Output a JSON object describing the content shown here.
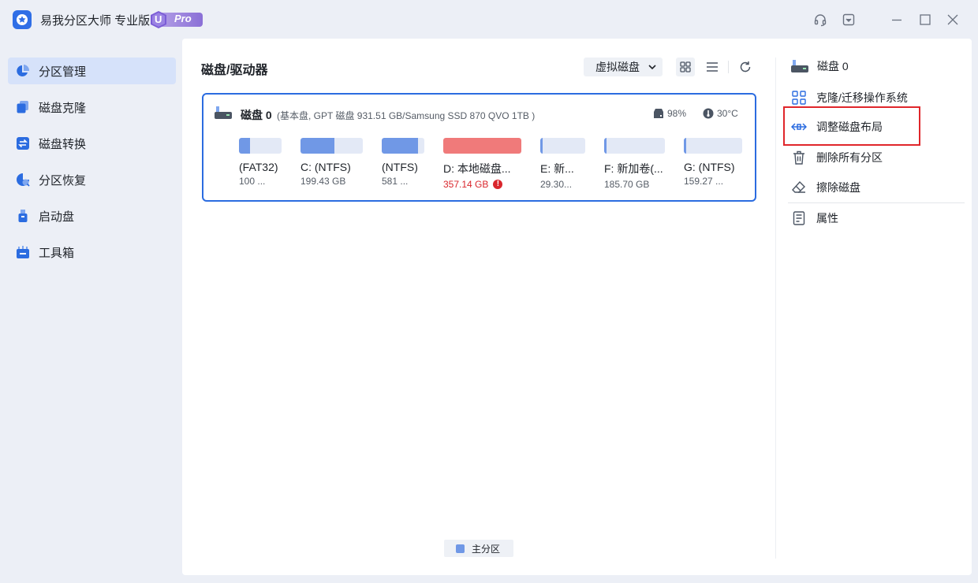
{
  "app": {
    "title": "易我分区大师 专业版",
    "badge": "Pro",
    "badge_letter": "U"
  },
  "window_controls": [
    "headset-icon",
    "dropdown-icon",
    "minimize-icon",
    "maximize-icon",
    "close-icon"
  ],
  "sidebar": {
    "items": [
      {
        "label": "分区管理",
        "icon": "pie-chart-icon",
        "active": true
      },
      {
        "label": "磁盘克隆",
        "icon": "clone-icon",
        "active": false
      },
      {
        "label": "磁盘转换",
        "icon": "convert-icon",
        "active": false
      },
      {
        "label": "分区恢复",
        "icon": "recovery-icon",
        "active": false
      },
      {
        "label": "启动盘",
        "icon": "usb-icon",
        "active": false
      },
      {
        "label": "工具箱",
        "icon": "toolbox-icon",
        "active": false
      }
    ]
  },
  "main": {
    "title": "磁盘/驱动器",
    "virtual_disk_label": "虚拟磁盘",
    "disk": {
      "name": "磁盘 0",
      "info": "(基本盘, GPT 磁盘 931.51 GB/Samsung SSD 870 QVO 1TB )",
      "health": "98%",
      "temperature": "30°C",
      "partitions": [
        {
          "name": "(FAT32)",
          "size": "100 ...",
          "used": 0.25,
          "warning": false
        },
        {
          "name": "C: (NTFS)",
          "size": "199.43 GB",
          "used": 0.55,
          "warning": false
        },
        {
          "name": "(NTFS)",
          "size": "581 ...",
          "used": 0.85,
          "warning": false
        },
        {
          "name": "D: 本地磁盘...",
          "size": "357.14 GB",
          "used": 1.0,
          "warning": true
        },
        {
          "name": "E: 新...",
          "size": "29.30...",
          "used": 0.06,
          "warning": false
        },
        {
          "name": "F: 新加卷(...",
          "size": "185.70 GB",
          "used": 0.04,
          "warning": false
        },
        {
          "name": "G: (NTFS)",
          "size": "159.27 ...",
          "used": 0.04,
          "warning": false
        }
      ]
    },
    "legend": "主分区"
  },
  "colors": {
    "accent": "#2b6ce0",
    "partition_fill": "#7098e6",
    "partition_warning": "#f07a7a",
    "partition_track": "#e3e9f6",
    "highlight": "#e0262b"
  },
  "right_panel": {
    "title": "磁盘 0",
    "actions": [
      {
        "label": "克隆/迁移操作系统",
        "icon": "clone-os-icon"
      },
      {
        "label": "调整磁盘布局",
        "icon": "resize-arrows-icon"
      },
      {
        "label": "删除所有分区",
        "icon": "trash-icon"
      },
      {
        "label": "擦除磁盘",
        "icon": "eraser-icon"
      },
      {
        "label": "属性",
        "icon": "properties-icon"
      }
    ]
  }
}
